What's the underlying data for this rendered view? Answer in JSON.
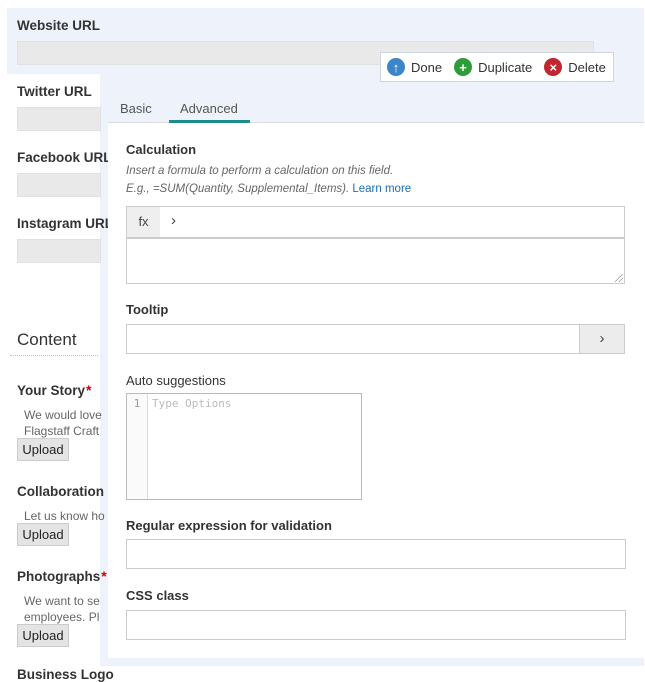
{
  "form": {
    "website_url": "Website URL",
    "twitter_url": "Twitter URL",
    "facebook_url": "Facebook URL",
    "instagram_url": "Instagram URL",
    "section_title": "Content",
    "your_story": "Your Story",
    "your_story_desc_1": "We would love",
    "your_story_desc_2": "Flagstaff Craft",
    "collaboration": "Collaboration",
    "collaboration_desc": "Let us know ho",
    "photographs": "Photographs",
    "photographs_desc_1": "We want to se",
    "photographs_desc_2": "employees. Pl",
    "business_logo": "Business Logo",
    "upload_label": "Upload",
    "required_mark": "*"
  },
  "toolbar": {
    "done": "Done",
    "duplicate": "Duplicate",
    "delete": "Delete",
    "colors": {
      "done": "#3a86c8",
      "duplicate": "#2e9c3a",
      "delete": "#c0262d"
    }
  },
  "panel": {
    "tabs": [
      "Basic",
      "Advanced"
    ],
    "active_tab": "Advanced",
    "calculation_label": "Calculation",
    "calculation_hint_1": "Insert a formula to perform a calculation on this field.",
    "calculation_hint_2": "E.g., =SUM(Quantity, Supplemental_Items).",
    "learn_more": "Learn more",
    "fx": "fx",
    "tooltip_label": "Tooltip",
    "auto_suggestions_label": "Auto suggestions",
    "line_number": "1",
    "options_placeholder": "Type Options",
    "regex_label": "Regular expression for validation",
    "css_class_label": "CSS class"
  }
}
